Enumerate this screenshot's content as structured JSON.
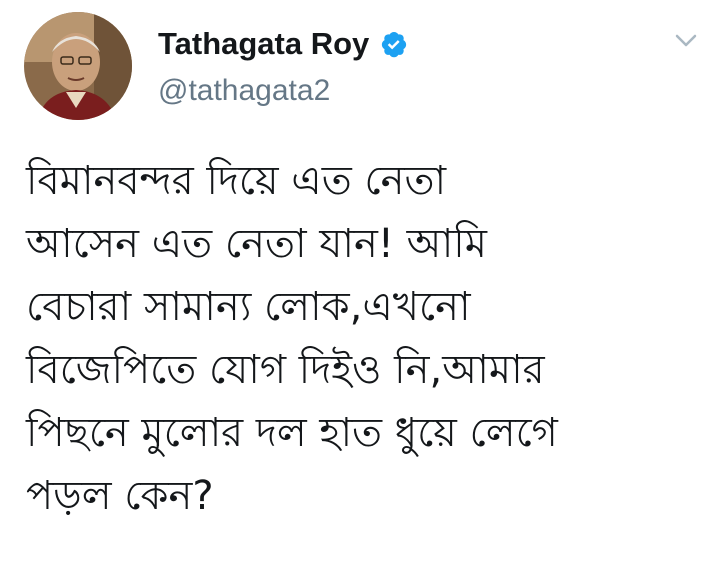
{
  "author": {
    "display_name": "Tathagata Roy",
    "handle": "@tathagata2",
    "verified": true,
    "avatar_icon": "profile-photo"
  },
  "menu": {
    "caret_icon": "chevron-down-icon"
  },
  "tweet": {
    "text": "বিমানবন্দর দিয়ে এত নেতা\nআসেন এত নেতা যান! আমি\nবেচারা সামান্য লোক,এখনো\nবিজেপিতে যোগ দিইও নি,আমার\nপিছনে মুলোর দল হাত ধুয়ে লেগে\nপড়ল কেন?"
  },
  "colors": {
    "verified_blue": "#1da1f2",
    "handle_gray": "#657786",
    "text_dark": "#14171a"
  }
}
